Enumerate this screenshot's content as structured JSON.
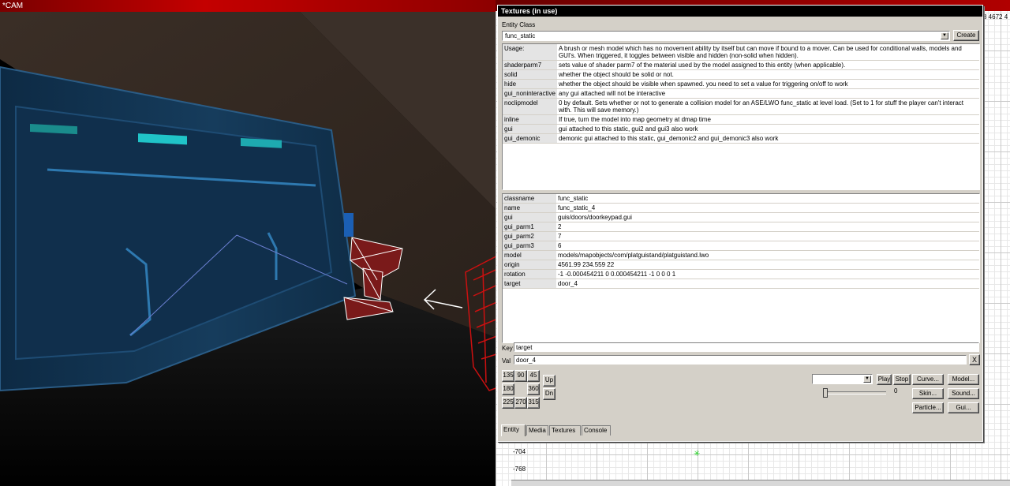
{
  "cam": {
    "title": "*CAM"
  },
  "grid": {
    "coord_top": "8 4672 4",
    "y_label_1": "-704",
    "y_label_2": "-768"
  },
  "dialog": {
    "title": "Textures (in use)",
    "entity_class_label": "Entity Class",
    "entity_class_value": "func_static",
    "create_label": "Create",
    "description": [
      {
        "key": "Usage:",
        "value": "A brush or mesh model which has no movement ability by itself but can move if bound to a mover. Can be used for conditional walls, models and GUI's. When triggered, it toggles between visible and hidden (non-solid when hidden)."
      },
      {
        "key": "shaderparm7",
        "value": "sets value of shader parm7 of the material used by the model assigned to this entity (when applicable)."
      },
      {
        "key": "solid",
        "value": "whether the object should be solid or not."
      },
      {
        "key": "hide",
        "value": "whether the object should be visible when spawned. you need to set a value for triggering on/off to work"
      },
      {
        "key": "gui_noninteractive",
        "value": "any gui attached will not be interactive"
      },
      {
        "key": "noclipmodel",
        "value": "0 by default. Sets whether or not to generate a collision model for an ASE/LWO func_static at level load. (Set to 1 for stuff the player can't interact with. This will save memory.)"
      },
      {
        "key": "inline",
        "value": "If true, turn the model into map geometry at dmap time"
      },
      {
        "key": "gui",
        "value": "gui attached to this static, gui2 and gui3 also work"
      },
      {
        "key": "gui_demonic",
        "value": "demonic gui attached to this static, gui_demonic2 and gui_demonic3 also work"
      }
    ],
    "properties": [
      {
        "key": "classname",
        "value": "func_static"
      },
      {
        "key": "name",
        "value": "func_static_4"
      },
      {
        "key": "gui",
        "value": "guis/doors/doorkeypad.gui"
      },
      {
        "key": "gui_parm1",
        "value": "2"
      },
      {
        "key": "gui_parm2",
        "value": "7"
      },
      {
        "key": "gui_parm3",
        "value": "6"
      },
      {
        "key": "model",
        "value": "models/mapobjects/com/platguistand/platguistand.lwo"
      },
      {
        "key": "origin",
        "value": "4561.99 234.559 22"
      },
      {
        "key": "rotation",
        "value": "-1 -0.000454211 0 0.000454211 -1 0 0 0 1"
      },
      {
        "key": "target",
        "value": "door_4"
      }
    ],
    "key_label": "Key",
    "key_value": "target",
    "val_label": "Val",
    "val_value": "door_4",
    "val_clear": "X",
    "angles": {
      "a135": "135",
      "a90": "90",
      "a45": "45",
      "a180": "180",
      "a360": "360",
      "a225": "225",
      "a270": "270",
      "a315": "315"
    },
    "up_label": "Up",
    "dn_label": "Dn",
    "play_label": "Play",
    "stop_label": "Stop",
    "slider_value": "0",
    "curve_label": "Curve...",
    "model_label": "Model...",
    "skin_label": "Skin...",
    "sound_label": "Sound...",
    "particle_label": "Particle...",
    "gui_label": "Gui...",
    "tabs": [
      "Entity",
      "Media",
      "Textures",
      "Console"
    ]
  }
}
